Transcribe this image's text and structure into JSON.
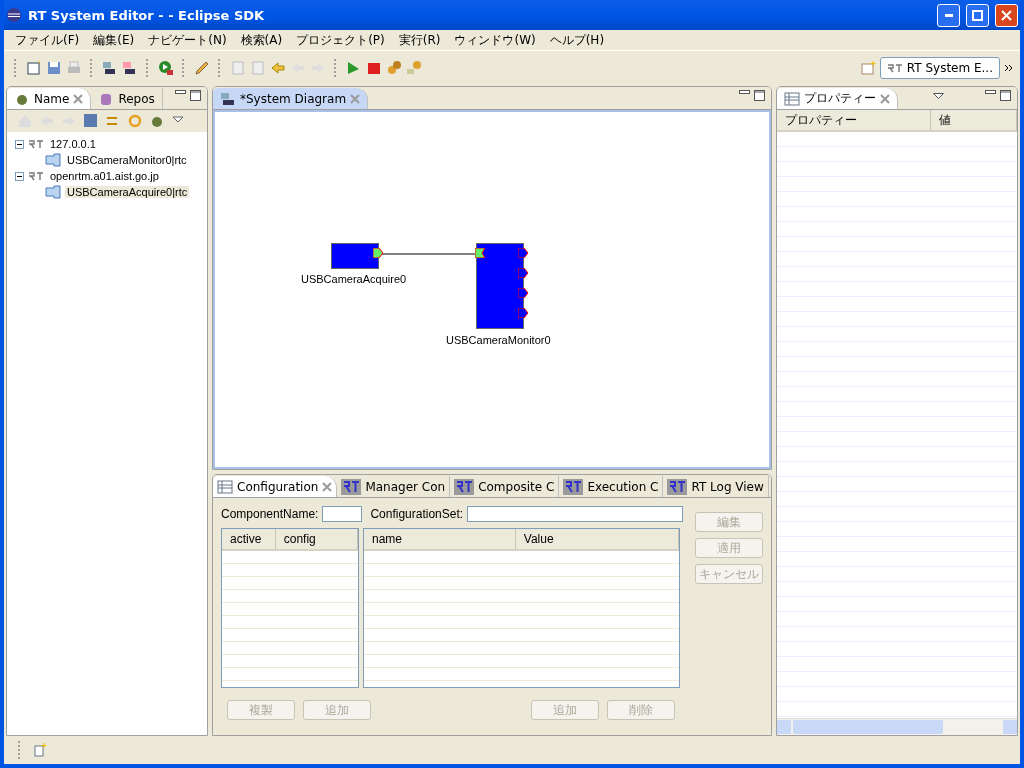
{
  "window": {
    "title": "RT System Editor -  - Eclipse SDK"
  },
  "menu": [
    "ファイル(F)",
    "編集(E)",
    "ナビゲート(N)",
    "検索(A)",
    "プロジェクト(P)",
    "実行(R)",
    "ウィンドウ(W)",
    "ヘルプ(H)"
  ],
  "perspective": {
    "label": "RT System E..."
  },
  "left_view": {
    "tabs": [
      {
        "label": "Name",
        "selected": true
      },
      {
        "label": "Repos",
        "selected": false
      }
    ],
    "tree": [
      {
        "label": "127.0.0.1",
        "expanded": true,
        "selected": false,
        "children": [
          {
            "label": "USBCameraMonitor0|rtc",
            "selected": false
          }
        ]
      },
      {
        "label": "openrtm.a01.aist.go.jp",
        "expanded": true,
        "selected": false,
        "children": [
          {
            "label": "USBCameraAcquire0|rtc",
            "selected": true
          }
        ]
      }
    ]
  },
  "editor": {
    "tab": {
      "label": "*System Diagram",
      "selected": true
    },
    "components": [
      {
        "name": "USBCameraAcquire0",
        "ports": [
          {
            "kind": "out",
            "connected": true
          }
        ]
      },
      {
        "name": "USBCameraMonitor0",
        "ports": [
          {
            "kind": "in",
            "connected": true
          },
          {
            "kind": "out",
            "connected": false
          },
          {
            "kind": "out",
            "connected": false
          },
          {
            "kind": "out",
            "connected": false
          },
          {
            "kind": "out",
            "connected": false
          }
        ]
      }
    ]
  },
  "bottom_view": {
    "tabs": [
      {
        "label": "Configuration",
        "selected": true
      },
      {
        "label": "Manager Con",
        "selected": false
      },
      {
        "label": "Composite C",
        "selected": false
      },
      {
        "label": "Execution C",
        "selected": false
      },
      {
        "label": "RT Log View",
        "selected": false
      }
    ],
    "component_name": {
      "label": "ComponentName:"
    },
    "configuration_set": {
      "label": "ConfigurationSet:"
    },
    "sets_table": {
      "columns": [
        "active",
        "config"
      ]
    },
    "params_table": {
      "columns": [
        "name",
        "Value"
      ]
    },
    "side_buttons": [
      {
        "label": "編集",
        "disabled": true
      },
      {
        "label": "適用",
        "disabled": true
      },
      {
        "label": "キャンセル",
        "disabled": true
      }
    ],
    "set_buttons": [
      {
        "label": "複製",
        "disabled": true
      },
      {
        "label": "追加",
        "disabled": true
      }
    ],
    "param_buttons": [
      {
        "label": "追加",
        "disabled": true
      },
      {
        "label": "削除",
        "disabled": true
      }
    ]
  },
  "properties_view": {
    "tab": {
      "label": "プロパティー",
      "selected": true
    },
    "columns": [
      "プロパティー",
      "値"
    ]
  }
}
